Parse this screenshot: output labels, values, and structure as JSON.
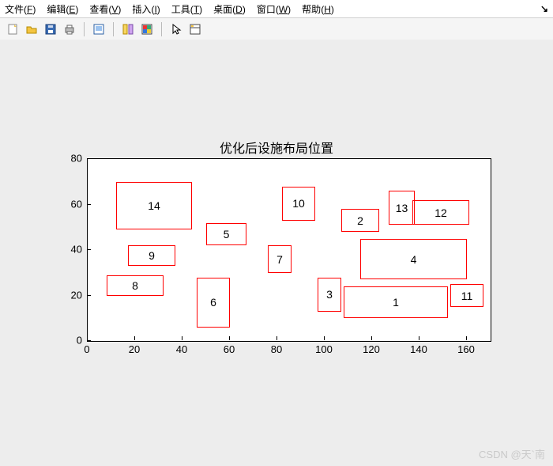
{
  "menus": {
    "file": {
      "text": "文件",
      "hotkey": "F"
    },
    "edit": {
      "text": "编辑",
      "hotkey": "E"
    },
    "view": {
      "text": "查看",
      "hotkey": "V"
    },
    "insert": {
      "text": "插入",
      "hotkey": "I"
    },
    "tools": {
      "text": "工具",
      "hotkey": "T"
    },
    "desktop": {
      "text": "桌面",
      "hotkey": "D"
    },
    "window": {
      "text": "窗口",
      "hotkey": "W"
    },
    "help": {
      "text": "帮助",
      "hotkey": "H"
    }
  },
  "watermark": "CSDN @天`南",
  "chart_data": {
    "type": "layout",
    "title": "优化后设施布局位置",
    "xlabel": "",
    "ylabel": "",
    "xlim": [
      0,
      170
    ],
    "ylim": [
      0,
      80
    ],
    "xticks": [
      0,
      20,
      40,
      60,
      80,
      100,
      120,
      140,
      160
    ],
    "yticks": [
      0,
      20,
      40,
      60,
      80
    ],
    "rects": [
      {
        "id": "1",
        "x1": 108,
        "y1": 10,
        "x2": 152,
        "y2": 24
      },
      {
        "id": "2",
        "x1": 107,
        "y1": 48,
        "x2": 123,
        "y2": 58
      },
      {
        "id": "3",
        "x1": 97,
        "y1": 13,
        "x2": 107,
        "y2": 28
      },
      {
        "id": "4",
        "x1": 115,
        "y1": 27,
        "x2": 160,
        "y2": 45
      },
      {
        "id": "5",
        "x1": 50,
        "y1": 42,
        "x2": 67,
        "y2": 52
      },
      {
        "id": "6",
        "x1": 46,
        "y1": 6,
        "x2": 60,
        "y2": 28
      },
      {
        "id": "7",
        "x1": 76,
        "y1": 30,
        "x2": 86,
        "y2": 42
      },
      {
        "id": "8",
        "x1": 8,
        "y1": 20,
        "x2": 32,
        "y2": 29
      },
      {
        "id": "9",
        "x1": 17,
        "y1": 33,
        "x2": 37,
        "y2": 42
      },
      {
        "id": "10",
        "x1": 82,
        "y1": 53,
        "x2": 96,
        "y2": 68
      },
      {
        "id": "11",
        "x1": 153,
        "y1": 15,
        "x2": 167,
        "y2": 25
      },
      {
        "id": "12",
        "x1": 137,
        "y1": 51,
        "x2": 161,
        "y2": 62
      },
      {
        "id": "13",
        "x1": 127,
        "y1": 51,
        "x2": 138,
        "y2": 66
      },
      {
        "id": "14",
        "x1": 12,
        "y1": 49,
        "x2": 44,
        "y2": 70
      }
    ]
  }
}
